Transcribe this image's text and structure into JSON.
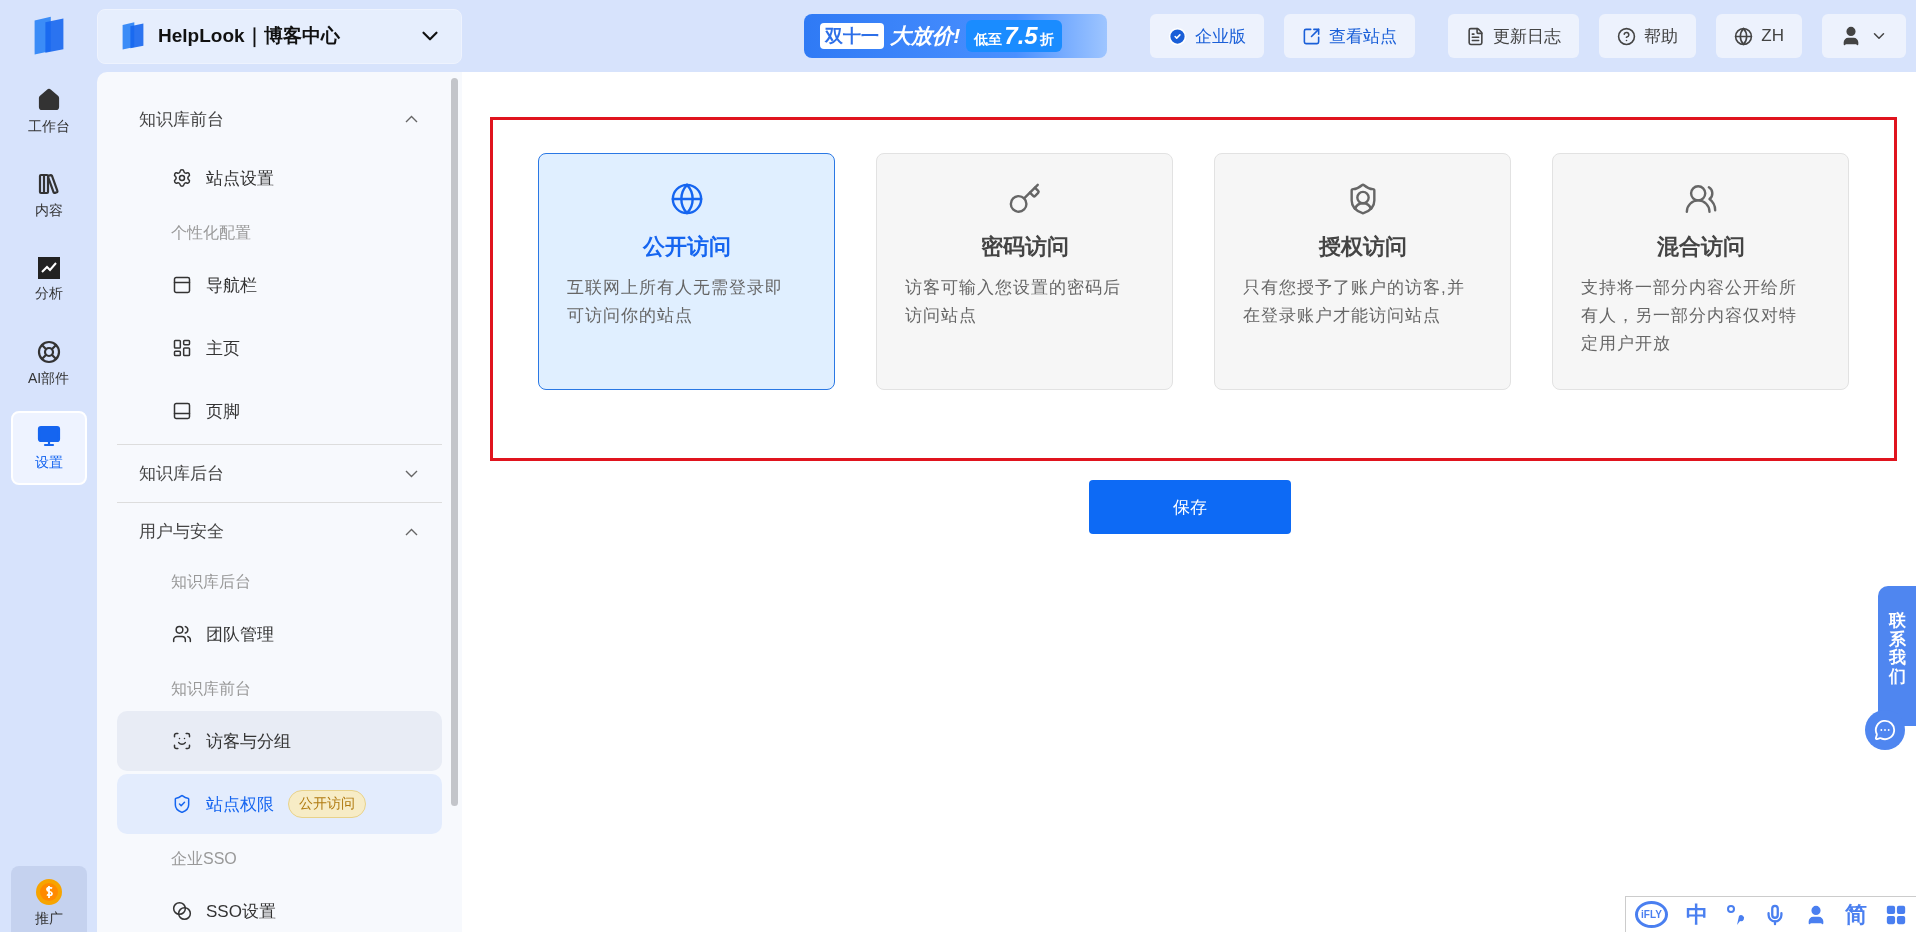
{
  "top_bar": {
    "workspace": "HelpLook｜博客中心",
    "promo": {
      "label": "双十一",
      "headline": "大放价!",
      "tag_prefix": "低至",
      "tag_value": "7.5",
      "tag_suffix": "折"
    },
    "buttons": [
      {
        "kind": "enterprise",
        "label": "企业版"
      },
      {
        "kind": "view",
        "label": "查看站点"
      },
      {
        "kind": "log",
        "label": "更新日志"
      },
      {
        "kind": "help",
        "label": "帮助"
      },
      {
        "kind": "lang",
        "label": "ZH"
      },
      {
        "kind": "user"
      }
    ]
  },
  "rail": {
    "items": [
      {
        "kind": "home",
        "label": "工作台",
        "selected": false
      },
      {
        "kind": "content",
        "label": "内容",
        "selected": false
      },
      {
        "kind": "analytics",
        "label": "分析",
        "selected": false
      },
      {
        "kind": "ai",
        "label": "AI部件",
        "selected": false
      },
      {
        "kind": "settings",
        "label": "设置",
        "selected": true
      }
    ],
    "promo": {
      "label": "推广"
    }
  },
  "sidebar": {
    "sections": [
      {
        "title": "知识库前台",
        "expanded": true,
        "items": [
          {
            "kind": "settings",
            "label": "站点设置",
            "selected": false,
            "hovered": false
          },
          {
            "kind": "subheading",
            "label": "个性化配置"
          },
          {
            "kind": "navbar",
            "label": "导航栏",
            "selected": false,
            "hovered": false
          },
          {
            "kind": "homepage",
            "label": "主页",
            "selected": false,
            "hovered": false
          },
          {
            "kind": "footer",
            "label": "页脚",
            "selected": false,
            "hovered": false
          }
        ]
      },
      {
        "title": "知识库后台",
        "expanded": false
      },
      {
        "title": "用户与安全",
        "expanded": true,
        "items": [
          {
            "kind": "subheading",
            "label": "知识库后台"
          },
          {
            "kind": "team",
            "label": "团队管理",
            "selected": false,
            "hovered": false
          },
          {
            "kind": "subheading",
            "label": "知识库前台"
          },
          {
            "kind": "visitors",
            "label": "访客与分组",
            "selected": false,
            "hovered": true
          },
          {
            "kind": "permissions",
            "label": "站点权限",
            "selected": true,
            "hovered": false,
            "badge": "公开访问"
          },
          {
            "kind": "subheading",
            "label": "企业SSO"
          },
          {
            "kind": "sso",
            "label": "SSO设置",
            "selected": false,
            "hovered": false
          }
        ]
      }
    ]
  },
  "access_options": {
    "highlighted": true,
    "options": [
      {
        "kind": "public",
        "title": "公开访问",
        "description": "互联网上所有人无需登录即可访问你的站点",
        "selected": true
      },
      {
        "kind": "password",
        "title": "密码访问",
        "description": "访客可输入您设置的密码后访问站点",
        "selected": false
      },
      {
        "kind": "authorized",
        "title": "授权访问",
        "description": "只有您授予了账户的访客,并在登录账户才能访问站点",
        "selected": false
      },
      {
        "kind": "mixed",
        "title": "混合访问",
        "description": "支持将一部分内容公开给所有人，另一部分内容仅对特定用户开放",
        "selected": false
      }
    ]
  },
  "save_button": "保存",
  "contact": {
    "label": "联系我们"
  },
  "ime_toolbar": {
    "items": [
      {
        "kind": "logo",
        "label": "iFLY"
      },
      {
        "kind": "text",
        "label": "中"
      },
      {
        "kind": "punct"
      },
      {
        "kind": "mic"
      },
      {
        "kind": "user"
      },
      {
        "kind": "text",
        "label": "简"
      },
      {
        "kind": "apps"
      }
    ]
  }
}
